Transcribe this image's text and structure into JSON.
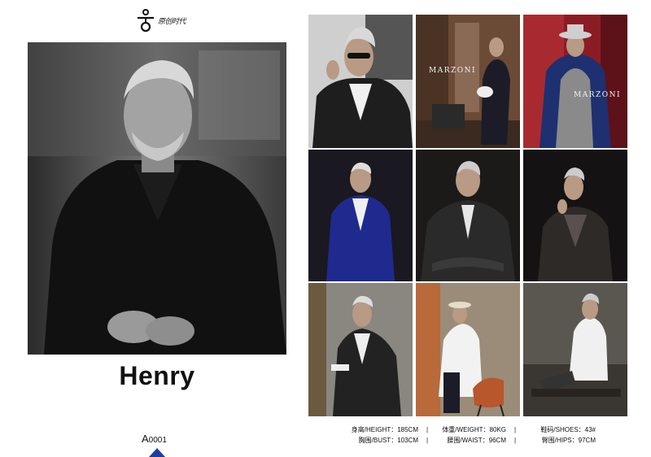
{
  "logo": {
    "text": "原创时代"
  },
  "model": {
    "name": "Henry",
    "code_prefix": "A",
    "code_number": "0001"
  },
  "stats": {
    "height": "身高/HEIGHT：185CM",
    "weight": "体重/WEIGHT：80KG",
    "shoes": "鞋码/SHOES：43#",
    "bust": "胸围/BUST：103CM",
    "waist": "腰围/WAIST：96CM",
    "hips": "臀围/HIPS：97CM",
    "separator": "|"
  },
  "gallery": {
    "brand_1": "MARZONI",
    "brand_2": "MARZONI"
  },
  "colors": {
    "accent": "#1c3f9e"
  }
}
